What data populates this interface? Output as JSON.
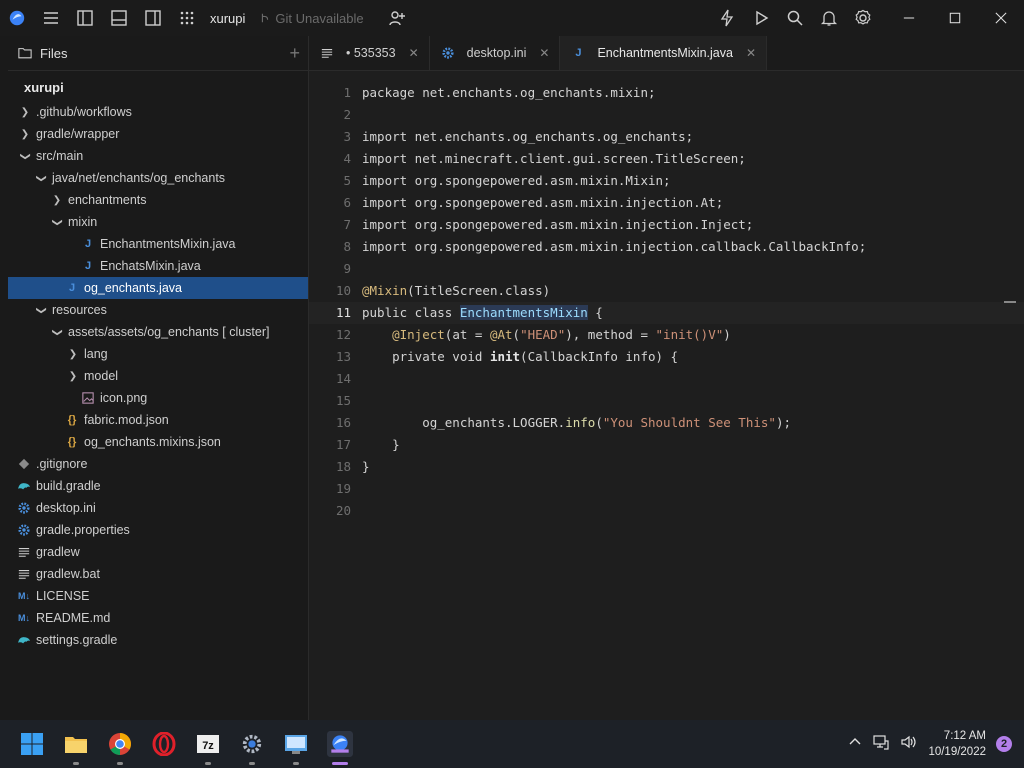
{
  "app": {
    "project_name": "xurupi",
    "git_status": "Git Unavailable"
  },
  "colors": {
    "accent": "#1f4f8a",
    "annotation": "#d7ba7d",
    "string": "#ce9178",
    "function": "#dcdcaa",
    "java_icon": "#4a8fdc",
    "json_icon": "#d7a442",
    "taskbar_accent": "#b37feb"
  },
  "sidebar": {
    "header": "Files",
    "root": "xurupi",
    "items": [
      {
        "label": ".github/workflows",
        "depth": 0,
        "chevron": "right",
        "icon": "none"
      },
      {
        "label": "gradle/wrapper",
        "depth": 0,
        "chevron": "right",
        "icon": "none"
      },
      {
        "label": "src/main",
        "depth": 0,
        "chevron": "down",
        "icon": "none"
      },
      {
        "label": "java/net/enchants/og_enchants",
        "depth": 1,
        "chevron": "down",
        "icon": "none"
      },
      {
        "label": "enchantments",
        "depth": 2,
        "chevron": "right",
        "icon": "none"
      },
      {
        "label": "mixin",
        "depth": 2,
        "chevron": "down",
        "icon": "none"
      },
      {
        "label": "EnchantmentsMixin.java",
        "depth": 3,
        "chevron": "",
        "icon": "java"
      },
      {
        "label": "EnchatsMixin.java",
        "depth": 3,
        "chevron": "",
        "icon": "java"
      },
      {
        "label": "og_enchants.java",
        "depth": 2,
        "chevron": "",
        "icon": "java",
        "selected": true
      },
      {
        "label": "resources",
        "depth": 1,
        "chevron": "down",
        "icon": "none"
      },
      {
        "label": "assets/assets/og_enchants [ cluster]",
        "depth": 2,
        "chevron": "down",
        "icon": "none"
      },
      {
        "label": "lang",
        "depth": 3,
        "chevron": "right",
        "icon": "none"
      },
      {
        "label": "model",
        "depth": 3,
        "chevron": "right",
        "icon": "none"
      },
      {
        "label": "icon.png",
        "depth": 3,
        "chevron": "",
        "icon": "image"
      },
      {
        "label": "fabric.mod.json",
        "depth": 2,
        "chevron": "",
        "icon": "json"
      },
      {
        "label": "og_enchants.mixins.json",
        "depth": 2,
        "chevron": "",
        "icon": "json"
      },
      {
        "label": ".gitignore",
        "depth": -1,
        "chevron": "",
        "icon": "git"
      },
      {
        "label": "build.gradle",
        "depth": -1,
        "chevron": "",
        "icon": "gradle"
      },
      {
        "label": "desktop.ini",
        "depth": -1,
        "chevron": "",
        "icon": "settings"
      },
      {
        "label": "gradle.properties",
        "depth": -1,
        "chevron": "",
        "icon": "settings"
      },
      {
        "label": "gradlew",
        "depth": -1,
        "chevron": "",
        "icon": "lines"
      },
      {
        "label": "gradlew.bat",
        "depth": -1,
        "chevron": "",
        "icon": "lines"
      },
      {
        "label": "LICENSE",
        "depth": -1,
        "chevron": "",
        "icon": "md"
      },
      {
        "label": "README.md",
        "depth": -1,
        "chevron": "",
        "icon": "md"
      },
      {
        "label": "settings.gradle",
        "depth": -1,
        "chevron": "",
        "icon": "gradle"
      }
    ]
  },
  "tabs": [
    {
      "label": "• 535353",
      "icon": "lines",
      "active": false
    },
    {
      "label": "desktop.ini",
      "icon": "settings",
      "active": false
    },
    {
      "label": "EnchantmentsMixin.java",
      "icon": "java",
      "active": true
    }
  ],
  "tab_close": "✕",
  "code": {
    "current_line": 11,
    "lines": [
      {
        "n": "1",
        "tokens": [
          [
            "txt",
            "package net.enchants.og_enchants.mixin;"
          ]
        ]
      },
      {
        "n": "2",
        "tokens": []
      },
      {
        "n": "3",
        "tokens": [
          [
            "txt",
            "import net.enchants.og_enchants.og_enchants;"
          ]
        ]
      },
      {
        "n": "4",
        "tokens": [
          [
            "txt",
            "import net.minecraft.client.gui.screen.TitleScreen;"
          ]
        ]
      },
      {
        "n": "5",
        "tokens": [
          [
            "txt",
            "import org.spongepowered.asm.mixin.Mixin;"
          ]
        ]
      },
      {
        "n": "6",
        "tokens": [
          [
            "txt",
            "import org.spongepowered.asm.mixin.injection.At;"
          ]
        ]
      },
      {
        "n": "7",
        "tokens": [
          [
            "txt",
            "import org.spongepowered.asm.mixin.injection.Inject;"
          ]
        ]
      },
      {
        "n": "8",
        "tokens": [
          [
            "txt",
            "import org.spongepowered.asm.mixin.injection.callback.CallbackInfo;"
          ]
        ]
      },
      {
        "n": "9",
        "tokens": []
      },
      {
        "n": "10",
        "tokens": [
          [
            "ann",
            "@Mixin"
          ],
          [
            "txt",
            "(TitleScreen.class)"
          ]
        ]
      },
      {
        "n": "11",
        "tokens": [
          [
            "txt",
            "public class "
          ],
          [
            "hl",
            "EnchantmentsMixin"
          ],
          [
            "txt",
            " {"
          ]
        ]
      },
      {
        "n": "12",
        "tokens": [
          [
            "txt",
            "    "
          ],
          [
            "ann",
            "@Inject"
          ],
          [
            "txt",
            "(at = "
          ],
          [
            "ann",
            "@At"
          ],
          [
            "txt",
            "("
          ],
          [
            "str",
            "\"HEAD\""
          ],
          [
            "txt",
            "), method = "
          ],
          [
            "str",
            "\"init()V\""
          ],
          [
            "txt",
            ")"
          ]
        ]
      },
      {
        "n": "13",
        "tokens": [
          [
            "txt",
            "    private void "
          ],
          [
            "bold",
            "init"
          ],
          [
            "txt",
            "(CallbackInfo info) {"
          ]
        ]
      },
      {
        "n": "14",
        "tokens": []
      },
      {
        "n": "15",
        "tokens": []
      },
      {
        "n": "16",
        "tokens": [
          [
            "txt",
            "        og_enchants.LOGGER."
          ],
          [
            "fn",
            "info"
          ],
          [
            "txt",
            "("
          ],
          [
            "str",
            "\"You Shouldnt See This\""
          ],
          [
            "txt",
            ");"
          ]
        ]
      },
      {
        "n": "17",
        "tokens": [
          [
            "txt",
            "    }"
          ]
        ]
      },
      {
        "n": "18",
        "tokens": [
          [
            "txt",
            "}"
          ]
        ]
      },
      {
        "n": "19",
        "tokens": []
      },
      {
        "n": "20",
        "tokens": []
      }
    ]
  },
  "taskbar": {
    "apps": [
      "windows-start",
      "file-explorer",
      "chrome",
      "opera",
      "7zip",
      "settings",
      "control-panel",
      "code-editor"
    ],
    "time": "7:12 AM",
    "date": "10/19/2022",
    "notification_count": "2"
  }
}
